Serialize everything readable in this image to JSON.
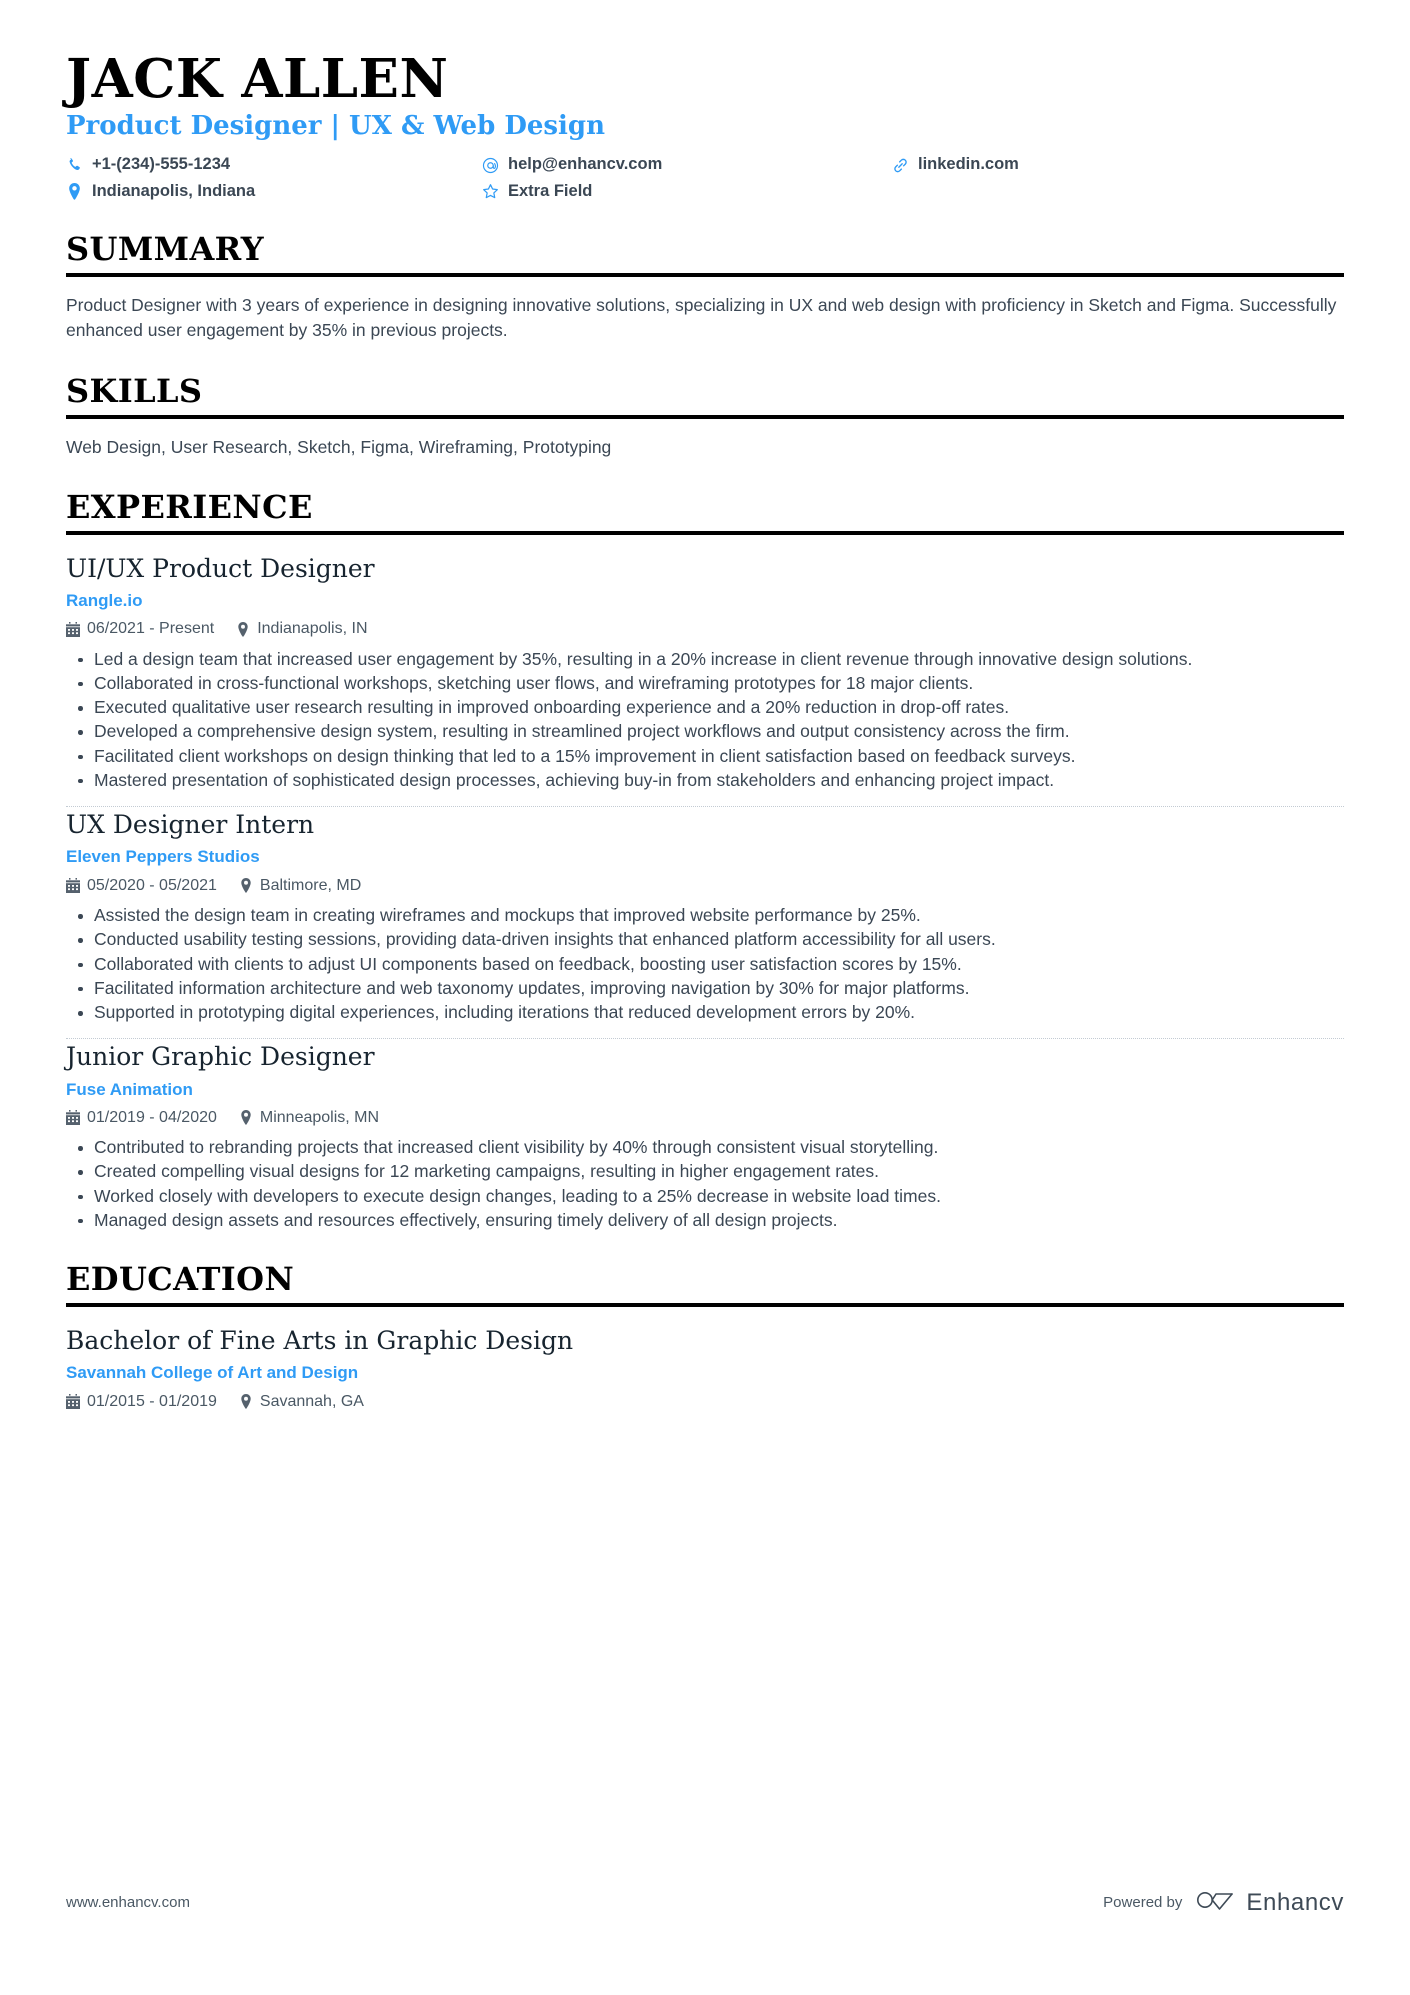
{
  "accent_color": "#2f9bf5",
  "text_color": "#3b4754",
  "header": {
    "name": "JACK ALLEN",
    "subtitle": "Product Designer | UX & Web Design",
    "contacts": [
      {
        "icon": "phone-icon",
        "text": "+1-(234)-555-1234"
      },
      {
        "icon": "email-icon",
        "text": "help@enhancv.com"
      },
      {
        "icon": "link-icon",
        "text": "linkedin.com"
      },
      {
        "icon": "location-icon",
        "text": "Indianapolis, Indiana"
      },
      {
        "icon": "star-icon",
        "text": "Extra Field"
      }
    ]
  },
  "sections": {
    "summary": {
      "title": "SUMMARY",
      "text": "Product Designer with 3 years of experience in designing innovative solutions, specializing in UX and web design with proficiency in Sketch and Figma. Successfully enhanced user engagement by 35% in previous projects."
    },
    "skills": {
      "title": "SKILLS",
      "text": "Web Design, User Research, Sketch, Figma, Wireframing, Prototyping"
    },
    "experience": {
      "title": "EXPERIENCE",
      "entries": [
        {
          "title": "UI/UX Product Designer",
          "org": "Rangle.io",
          "dates": "06/2021 - Present",
          "location": "Indianapolis, IN",
          "bullets": [
            "Led a design team that increased user engagement by 35%, resulting in a 20% increase in client revenue through innovative design solutions.",
            "Collaborated in cross-functional workshops, sketching user flows, and wireframing prototypes for 18 major clients.",
            "Executed qualitative user research resulting in improved onboarding experience and a 20% reduction in drop-off rates.",
            "Developed a comprehensive design system, resulting in streamlined project workflows and output consistency across the firm.",
            "Facilitated client workshops on design thinking that led to a 15% improvement in client satisfaction based on feedback surveys.",
            "Mastered presentation of sophisticated design processes, achieving buy-in from stakeholders and enhancing project impact."
          ]
        },
        {
          "title": "UX Designer Intern",
          "org": "Eleven Peppers Studios",
          "dates": "05/2020 - 05/2021",
          "location": "Baltimore, MD",
          "bullets": [
            "Assisted the design team in creating wireframes and mockups that improved website performance by 25%.",
            "Conducted usability testing sessions, providing data-driven insights that enhanced platform accessibility for all users.",
            "Collaborated with clients to adjust UI components based on feedback, boosting user satisfaction scores by 15%.",
            "Facilitated information architecture and web taxonomy updates, improving navigation by 30% for major platforms.",
            "Supported in prototyping digital experiences, including iterations that reduced development errors by 20%."
          ]
        },
        {
          "title": "Junior Graphic Designer",
          "org": "Fuse Animation",
          "dates": "01/2019 - 04/2020",
          "location": "Minneapolis, MN",
          "bullets": [
            "Contributed to rebranding projects that increased client visibility by 40% through consistent visual storytelling.",
            "Created compelling visual designs for 12 marketing campaigns, resulting in higher engagement rates.",
            "Worked closely with developers to execute design changes, leading to a 25% decrease in website load times.",
            "Managed design assets and resources effectively, ensuring timely delivery of all design projects."
          ]
        }
      ]
    },
    "education": {
      "title": "EDUCATION",
      "entries": [
        {
          "title": "Bachelor of Fine Arts in Graphic Design",
          "org": "Savannah College of Art and Design",
          "dates": "01/2015 - 01/2019",
          "location": "Savannah, GA"
        }
      ]
    }
  },
  "footer": {
    "url": "www.enhancv.com",
    "powered_by": "Powered by",
    "brand": "Enhancv"
  }
}
